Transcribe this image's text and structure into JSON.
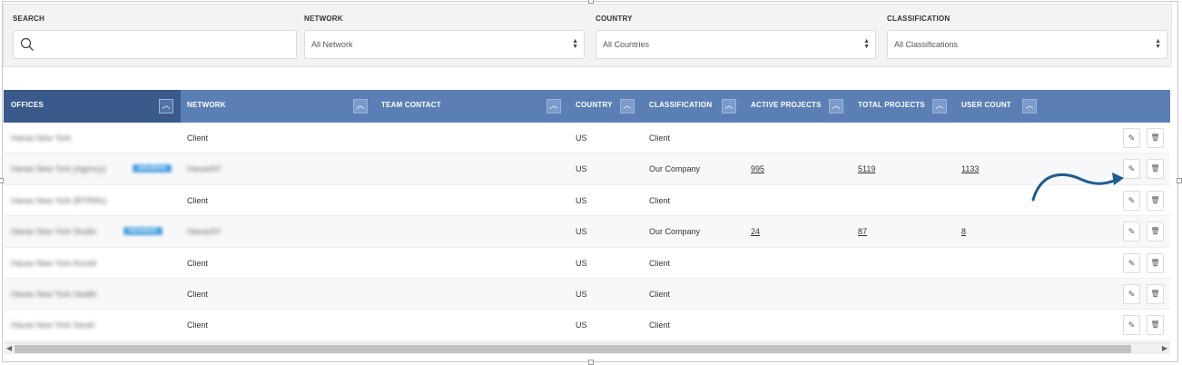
{
  "filters": {
    "search_label": "SEARCH",
    "search_placeholder": "",
    "network_label": "NETWORK",
    "network_value": "All Network",
    "country_label": "COUNTRY",
    "country_value": "All Countries",
    "classification_label": "CLASSIFICATION",
    "classification_value": "All Classifications"
  },
  "table": {
    "columns": [
      {
        "key": "offices",
        "label": "OFFICES"
      },
      {
        "key": "network",
        "label": "NETWORK"
      },
      {
        "key": "team_contact",
        "label": "TEAM CONTACT"
      },
      {
        "key": "country",
        "label": "COUNTRY"
      },
      {
        "key": "classification",
        "label": "CLASSIFICATION"
      },
      {
        "key": "active_projects",
        "label": "ACTIVE PROJECTS"
      },
      {
        "key": "total_projects",
        "label": "TOTAL PROJECTS"
      },
      {
        "key": "user_count",
        "label": "USER COUNT"
      }
    ],
    "rows": [
      {
        "office": "Havas New York",
        "badge": "",
        "network": "Client",
        "network_blurred": false,
        "country": "US",
        "classification": "Client",
        "active": "",
        "total": "",
        "users": ""
      },
      {
        "office": "Havas New York (Agency)",
        "badge": "MEMBER",
        "network": "HavasNY",
        "network_blurred": true,
        "country": "US",
        "classification": "Our Company",
        "active": "995",
        "total": "5119",
        "users": "1133"
      },
      {
        "office": "Havas New York (BTRWs)",
        "badge": "",
        "network": "Client",
        "network_blurred": false,
        "country": "US",
        "classification": "Client",
        "active": "",
        "total": "",
        "users": ""
      },
      {
        "office": "Havas New York Studio",
        "badge": "MEMBER",
        "network": "HavasNY",
        "network_blurred": true,
        "country": "US",
        "classification": "Our Company",
        "active": "24",
        "total": "87",
        "users": "8"
      },
      {
        "office": "Havas New York Arnold",
        "badge": "",
        "network": "Client",
        "network_blurred": false,
        "country": "US",
        "classification": "Client",
        "active": "",
        "total": "",
        "users": ""
      },
      {
        "office": "Havas New York Health",
        "badge": "",
        "network": "Client",
        "network_blurred": false,
        "country": "US",
        "classification": "Client",
        "active": "",
        "total": "",
        "users": ""
      },
      {
        "office": "Havas New York Sarah",
        "badge": "",
        "network": "Client",
        "network_blurred": false,
        "country": "US",
        "classification": "Client",
        "active": "",
        "total": "",
        "users": ""
      }
    ]
  },
  "icons": {
    "sort": "chevron-up-icon",
    "edit": "pencil-icon",
    "delete": "trash-icon",
    "search": "search-icon"
  },
  "colors": {
    "header_bg": "#5b7fb5",
    "header_active_bg": "#3b5a8c",
    "badge": "#4fa3e0",
    "annotation_arrow": "#1f5b8e"
  }
}
